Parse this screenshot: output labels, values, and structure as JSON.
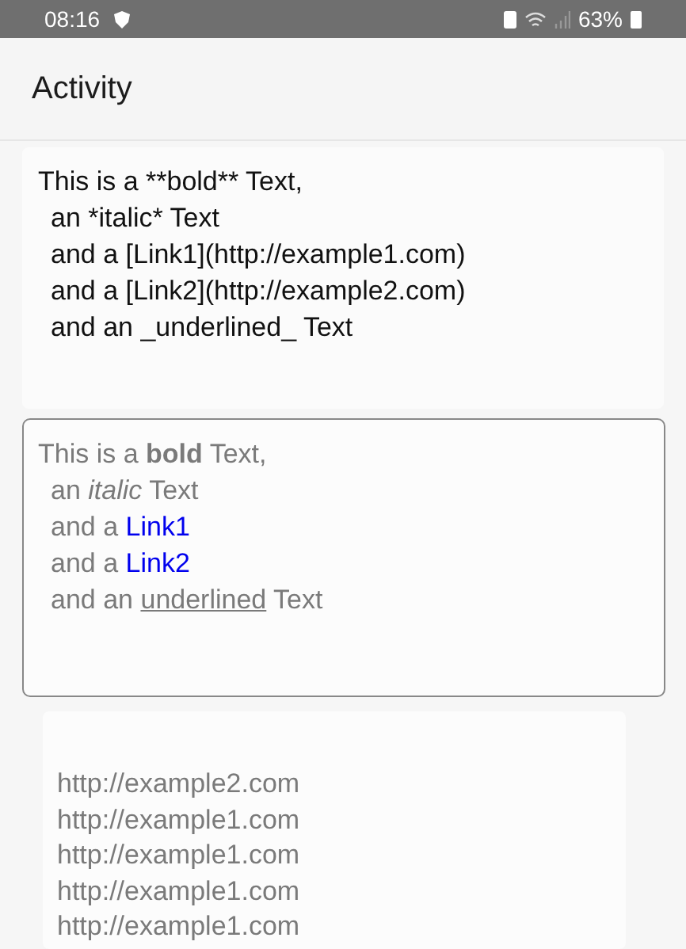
{
  "status_bar": {
    "time": "08:16",
    "battery": "63%"
  },
  "app_bar": {
    "title": "Activity"
  },
  "source_lines": [
    "This is a **bold** Text,",
    "an *italic* Text",
    "and a [Link1](http://example1.com)",
    "and a [Link2](http://example2.com)",
    "and an _underlined_ Text"
  ],
  "rendered_lines": [
    [
      {
        "kind": "plain",
        "text": "This is a "
      },
      {
        "kind": "bold",
        "text": "bold"
      },
      {
        "kind": "plain",
        "text": " Text,"
      }
    ],
    [
      {
        "kind": "plain",
        "text": "an "
      },
      {
        "kind": "italic",
        "text": "italic"
      },
      {
        "kind": "plain",
        "text": " Text"
      }
    ],
    [
      {
        "kind": "plain",
        "text": "and a "
      },
      {
        "kind": "link",
        "text": "Link1"
      }
    ],
    [
      {
        "kind": "plain",
        "text": "and a "
      },
      {
        "kind": "link",
        "text": "Link2"
      }
    ],
    [
      {
        "kind": "plain",
        "text": "and an "
      },
      {
        "kind": "underline",
        "text": "underlined"
      },
      {
        "kind": "plain",
        "text": " Text"
      }
    ]
  ],
  "url_log": [
    "http://example2.com",
    "http://example1.com",
    "http://example1.com",
    "http://example1.com",
    "http://example1.com"
  ]
}
